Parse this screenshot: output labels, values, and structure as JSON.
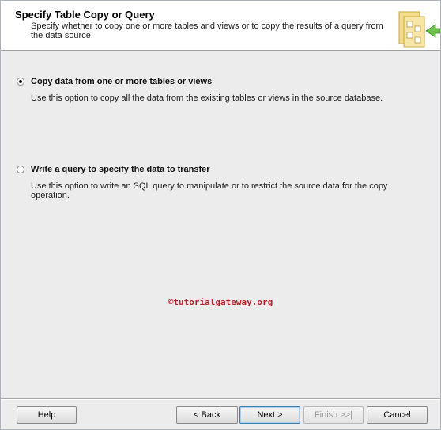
{
  "header": {
    "title": "Specify Table Copy or Query",
    "description": "Specify whether to copy one or more tables and views or to copy the results of a query from the data source.",
    "icon": "wizard-folder-icon"
  },
  "options": [
    {
      "label": "Copy data from one or more tables or views",
      "description": "Use this option to copy all the data from the existing tables or views in the source database.",
      "selected": true
    },
    {
      "label": "Write a query to specify the data to transfer",
      "description": "Use this option to write an SQL query to manipulate or to restrict the source data for the copy operation.",
      "selected": false
    }
  ],
  "watermark": "©tutorialgateway.org",
  "buttons": {
    "help": "Help",
    "back": "< Back",
    "next": "Next >",
    "finish": "Finish >>|",
    "cancel": "Cancel"
  },
  "colors": {
    "dialog_background": "#ececec",
    "header_background": "#ffffff",
    "watermark": "#b6202a",
    "icon_arrow": "#6cc24a"
  }
}
